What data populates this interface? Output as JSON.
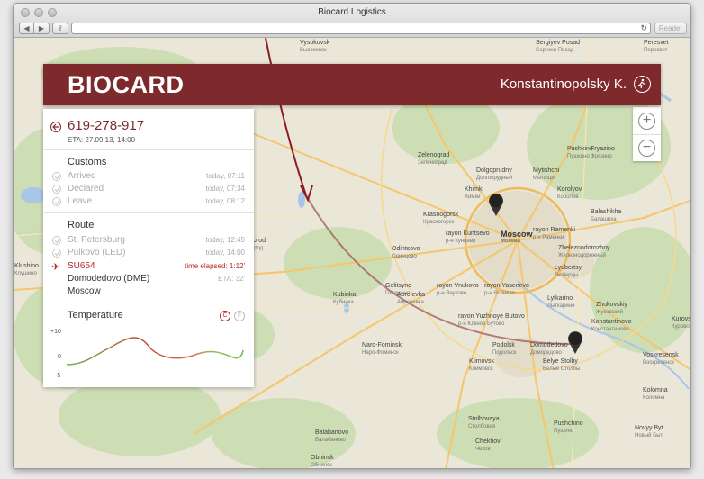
{
  "window": {
    "title": "Biocard Logistics",
    "reader_label": "Reader"
  },
  "header": {
    "logo": "BIOCARD",
    "user_name": "Konstantinopolsky K."
  },
  "shipment": {
    "id": "619-278-917",
    "eta": "ETA: 27.09.13, 14:00"
  },
  "customs": {
    "title": "Customs",
    "items": [
      {
        "name": "Arrived",
        "time": "today, 07:11"
      },
      {
        "name": "Declared",
        "time": "today, 07:34"
      },
      {
        "name": "Leave",
        "time": "today, 08:12"
      }
    ]
  },
  "route": {
    "title": "Route",
    "done": [
      {
        "name": "St. Petersburg",
        "time": "today, 12:45"
      },
      {
        "name": "Pulkovo (LED)",
        "time": "today, 14:00"
      }
    ],
    "current": {
      "name": "SU654",
      "time": "time elapsed: 1:12'"
    },
    "next": [
      {
        "name": "Domodedovo (DME)",
        "time": "ETA: 32'"
      },
      {
        "name": "Moscow",
        "time": ""
      }
    ]
  },
  "temperature": {
    "title": "Temperature",
    "unit_c": "C",
    "unit_f": "F",
    "ticks": [
      "+10",
      "0",
      "-5"
    ]
  },
  "zoom": {
    "in": "+",
    "out": "−"
  },
  "map_labels": [
    {
      "t": "Vysokovsk",
      "s": "Высоковск"
    },
    {
      "t": "Sergiyev Posad",
      "s": "Сергиев Посад"
    },
    {
      "t": "Peresvet",
      "s": "Пересвет"
    },
    {
      "t": "Zelenograd",
      "s": "Зеленоград"
    },
    {
      "t": "Dolgoprudny",
      "s": "Долгопрудный"
    },
    {
      "t": "Mytishchi",
      "s": "Мытищи"
    },
    {
      "t": "Khimki",
      "s": "Химки"
    },
    {
      "t": "Korolyov",
      "s": "Королёв"
    },
    {
      "t": "Pushkino",
      "s": "Пушкино"
    },
    {
      "t": "Fryazino",
      "s": "Фрязино"
    },
    {
      "t": "Balashikha",
      "s": "Балашиха"
    },
    {
      "t": "Krasnogorsk",
      "s": "Красногорск"
    },
    {
      "t": "Moscow",
      "s": "Москва"
    },
    {
      "t": "rayon Kuntsevo",
      "s": "р-н Кунцево"
    },
    {
      "t": "rayon Ramenki",
      "s": "р-н Раменки"
    },
    {
      "t": "Zheleznodorozhny",
      "s": "Железнодорожный"
    },
    {
      "t": "Zvenigorod",
      "s": "Звенигород"
    },
    {
      "t": "Odintsovo",
      "s": "Одинцово"
    },
    {
      "t": "Lyubertsy",
      "s": "Люберцы"
    },
    {
      "t": "Golitsyno",
      "s": "Голицыно"
    },
    {
      "t": "rayon Vnukovo",
      "s": "р-н Внуково"
    },
    {
      "t": "rayon Yasenevo",
      "s": "р-н Ясенево"
    },
    {
      "t": "Lytkarino",
      "s": "Лыткарино"
    },
    {
      "t": "Zhukovskiy",
      "s": "Жуковский"
    },
    {
      "t": "Kubinka",
      "s": "Кубинка"
    },
    {
      "t": "Aprelevka",
      "s": "Апрелевка"
    },
    {
      "t": "rayon Yuzhnoye Butovo",
      "s": "р-н Южное Бутово"
    },
    {
      "t": "Naro-Fominsk",
      "s": "Наро-Фоминск"
    },
    {
      "t": "Podolsk",
      "s": "Подольск"
    },
    {
      "t": "Domodedovo",
      "s": "Домодедово"
    },
    {
      "t": "Konstantinovo",
      "s": "Константиново"
    },
    {
      "t": "Klimovsk",
      "s": "Климовск"
    },
    {
      "t": "Belye Stolby",
      "s": "Белые Столбы"
    },
    {
      "t": "Chekhov",
      "s": "Чехов"
    },
    {
      "t": "Balabanovo",
      "s": "Балабаново"
    },
    {
      "t": "Obninsk",
      "s": "Обнинск"
    },
    {
      "t": "Voskresensk",
      "s": "Воскресенск"
    },
    {
      "t": "Kolomna",
      "s": "Коломна"
    },
    {
      "t": "Kurovskoye",
      "s": "Куровское"
    },
    {
      "t": "Klushino",
      "s": "Клушино"
    },
    {
      "t": "Novyy Byt",
      "s": "Новый Быт"
    },
    {
      "t": "Stolbovaya",
      "s": "Столбовая"
    },
    {
      "t": "Pushchino",
      "s": "Пущино"
    }
  ]
}
